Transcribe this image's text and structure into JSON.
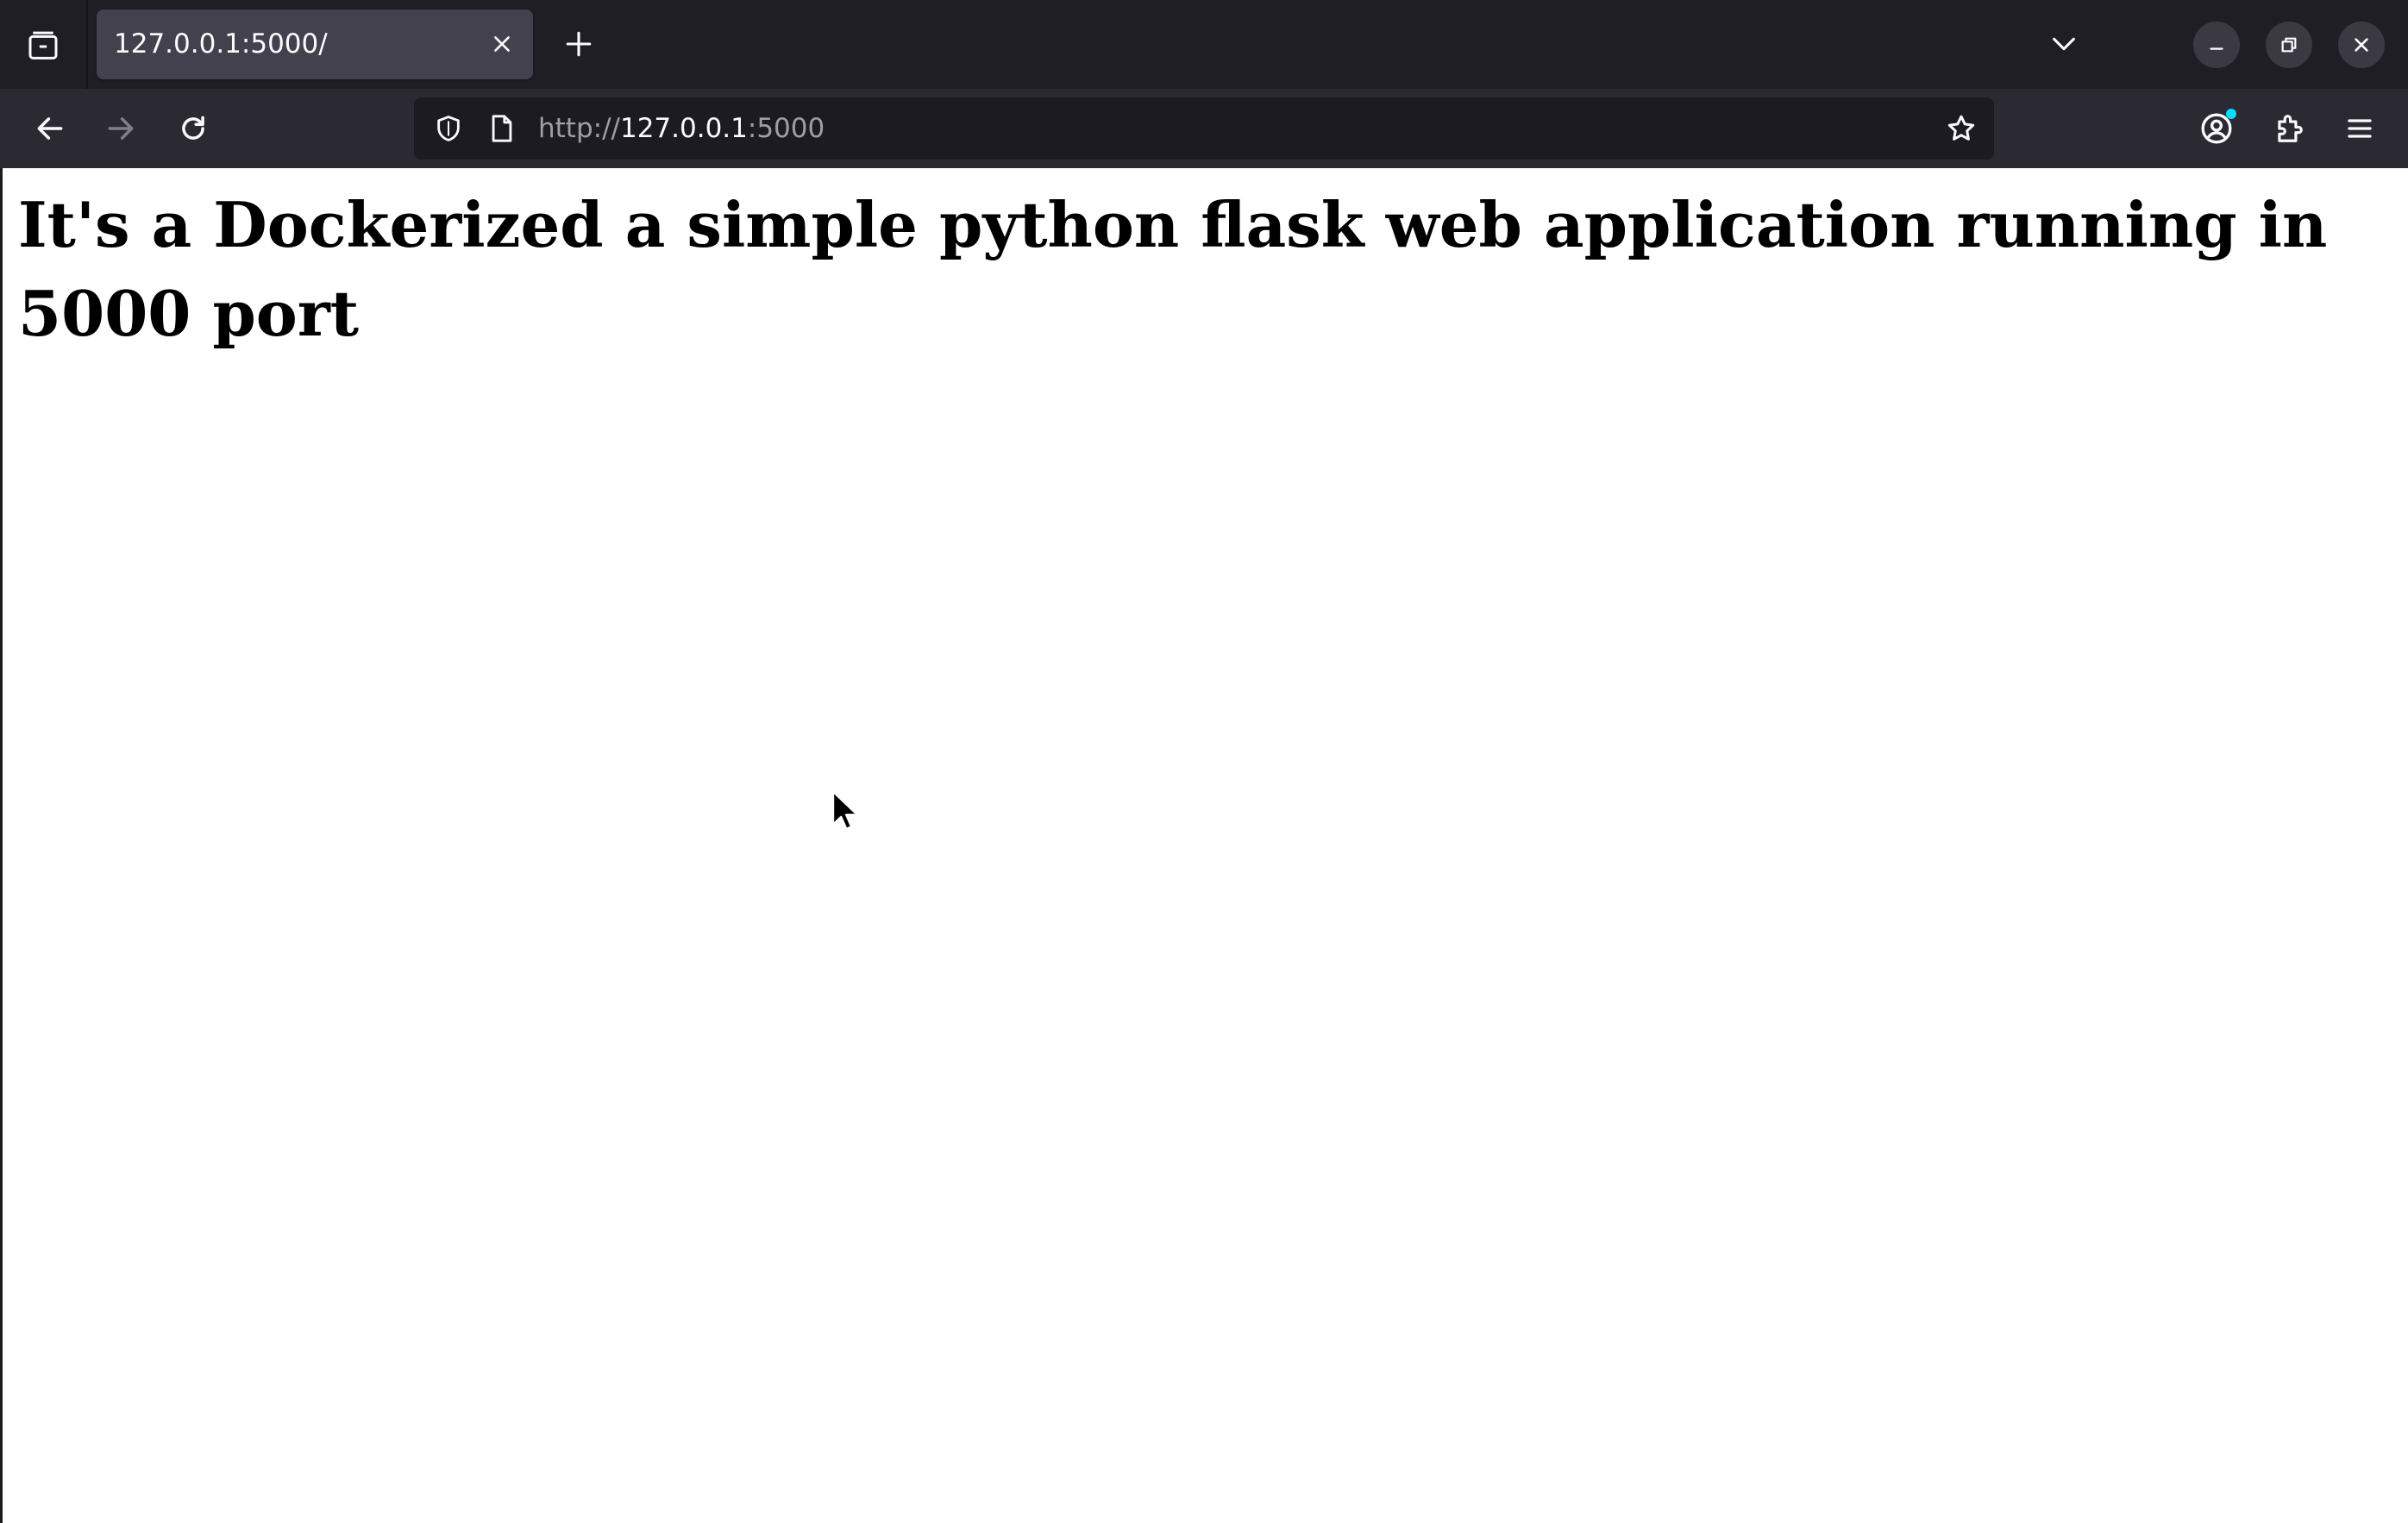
{
  "browser": {
    "tab": {
      "title": "127.0.0.1:5000/"
    },
    "urlbar": {
      "scheme": "http://",
      "host": "127.0.0.1",
      "port": ":5000"
    },
    "icons": {
      "tab_overview": "tab-overview-icon",
      "tab_close": "close-icon",
      "new_tab": "plus-icon",
      "tab_list": "chevron-down-icon",
      "minimize": "minimize-icon",
      "restore": "restore-icon",
      "close_window": "close-icon",
      "back": "arrow-left-icon",
      "forward": "arrow-right-icon",
      "reload": "reload-icon",
      "tracking_protection": "shield-icon",
      "page_info": "page-icon",
      "bookmark": "star-icon",
      "account": "account-icon",
      "extensions": "puzzle-icon",
      "app_menu": "hamburger-icon"
    },
    "colors": {
      "tabstrip_bg": "#1f1e25",
      "active_tab_bg": "#42414d",
      "navbar_bg": "#2b2a33",
      "urlbar_bg": "#1c1b22",
      "text_primary": "#fbfbfe",
      "text_dim": "#9e9ea6",
      "account_badge": "#00ddff"
    }
  },
  "page": {
    "heading": "It's a Dockerized a simple python flask web application running in 5000 port"
  }
}
